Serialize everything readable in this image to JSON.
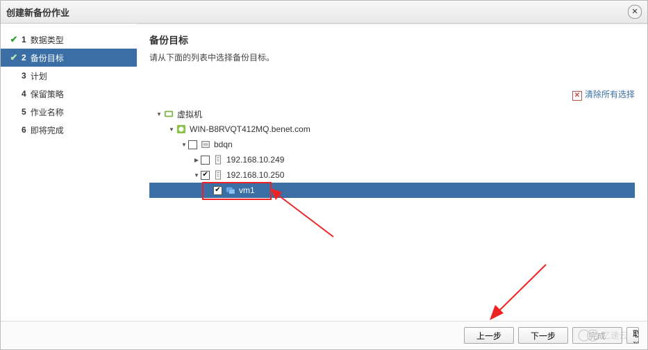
{
  "window": {
    "title": "创建新备份作业"
  },
  "steps": [
    {
      "num": "1",
      "label": "数据类型",
      "done": true,
      "active": false
    },
    {
      "num": "2",
      "label": "备份目标",
      "done": true,
      "active": true
    },
    {
      "num": "3",
      "label": "计划",
      "done": false,
      "active": false
    },
    {
      "num": "4",
      "label": "保留策略",
      "done": false,
      "active": false
    },
    {
      "num": "5",
      "label": "作业名称",
      "done": false,
      "active": false
    },
    {
      "num": "6",
      "label": "即将完成",
      "done": false,
      "active": false
    }
  ],
  "panel": {
    "heading": "备份目标",
    "description": "请从下面的列表中选择备份目标。",
    "clear_all": "清除所有选择"
  },
  "tree": {
    "root": {
      "label": "虚拟机"
    },
    "host": {
      "label": "WIN-B8RVQT412MQ.benet.com"
    },
    "dc": {
      "label": "bdqn"
    },
    "node1": {
      "label": "192.168.10.249",
      "checked": false
    },
    "node2": {
      "label": "192.168.10.250",
      "checked": true
    },
    "vm": {
      "label": "vm1",
      "checked": true,
      "selected": true
    }
  },
  "buttons": {
    "prev": "上一步",
    "next": "下一步",
    "finish": "完成",
    "cancel": "取消"
  },
  "watermark": "亿速云"
}
